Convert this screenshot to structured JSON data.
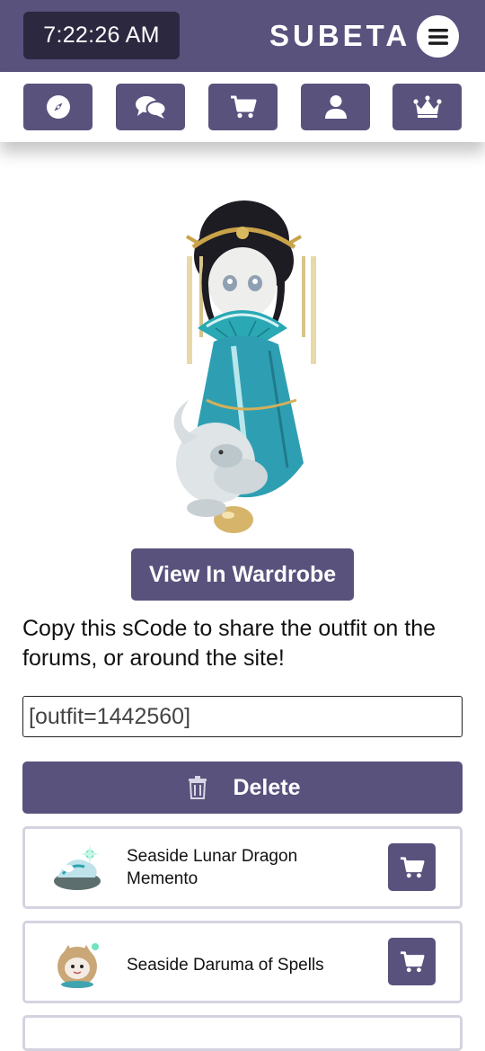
{
  "header": {
    "clock": "7:22:26 AM",
    "logo": "SUBETA",
    "menu_icon": "hamburger-icon",
    "bg_color": "#59527d",
    "clock_bg": "#2b2840"
  },
  "nav": [
    {
      "icon": "compass-icon"
    },
    {
      "icon": "chat-bubbles-icon"
    },
    {
      "icon": "shopping-cart-icon"
    },
    {
      "icon": "user-icon"
    },
    {
      "icon": "crown-icon"
    }
  ],
  "main": {
    "wardrobe_button": "View In Wardrobe",
    "copy_text": "Copy this sCode to share the outfit on the forums, or around the site!",
    "scode_value": "[outfit=1442560]",
    "delete_button": "Delete",
    "delete_icon": "trash-icon"
  },
  "items": [
    {
      "name": "Seaside Lunar Dragon Memento",
      "cart_icon": "shopping-cart-icon"
    },
    {
      "name": "Seaside Daruma of Spells",
      "cart_icon": "shopping-cart-icon"
    }
  ]
}
